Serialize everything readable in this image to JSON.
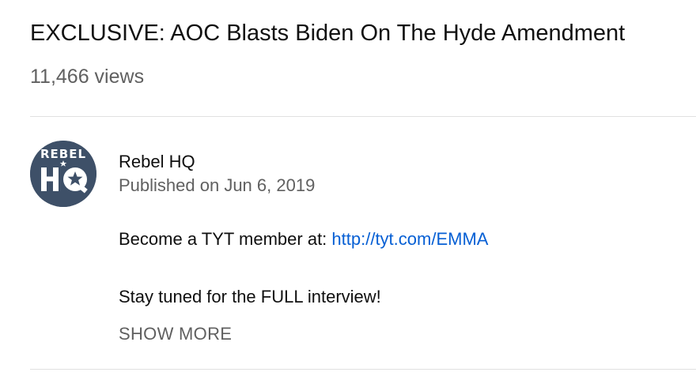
{
  "video": {
    "title": "EXCLUSIVE: AOC Blasts Biden On The Hyde Amendment",
    "views": "11,466 views"
  },
  "channel": {
    "name": "Rebel HQ",
    "published": "Published on Jun 6, 2019",
    "avatar": {
      "icon": "rebel-hq-logo-icon",
      "text_top": "REBEL",
      "text_bottom": "HQ",
      "background_color": "#3e5068",
      "foreground_color": "#ffffff"
    }
  },
  "description": {
    "line1_prefix": "Become a TYT member at: ",
    "line1_link": "http://tyt.com/EMMA",
    "line2": "Stay tuned for the FULL interview!",
    "show_more_label": "SHOW MORE"
  },
  "colors": {
    "link": "#065fd4",
    "secondary_text": "#606060",
    "divider": "#e0e0e0"
  }
}
